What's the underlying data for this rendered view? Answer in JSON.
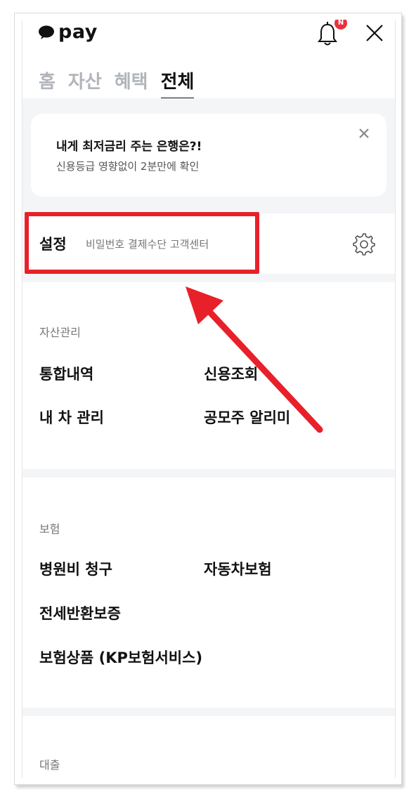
{
  "header": {
    "logo_text": "pay",
    "notification_badge": "N",
    "tabs": [
      "홈",
      "자산",
      "혜택",
      "전체"
    ],
    "active_tab": "전체"
  },
  "promo": {
    "title": "내게 최저금리 주는 은행은?!",
    "subtitle": "신용등급 영향없이 2분만에 확인"
  },
  "settings": {
    "title": "설정",
    "subtitle": "비밀번호 결제수단 고객센터"
  },
  "sections": {
    "asset": {
      "label": "자산관리",
      "items": [
        "통합내역",
        "신용조회",
        "내 차 관리",
        "공모주 알리미"
      ]
    },
    "insurance": {
      "label": "보험",
      "items": [
        "병원비 청구",
        "자동차보험",
        "전세반환보증",
        "보험상품 (KP보험서비스)"
      ]
    },
    "loan": {
      "label": "대출"
    }
  },
  "colors": {
    "accent_red": "#e8202a",
    "badge_red": "#e8323c",
    "section_gray": "#f4f5f7",
    "tab_inactive": "#b1b5bb"
  },
  "icons": {
    "logo": "speech-bubble-icon",
    "notification": "bell-icon",
    "close": "close-icon",
    "settings": "gear-icon"
  }
}
